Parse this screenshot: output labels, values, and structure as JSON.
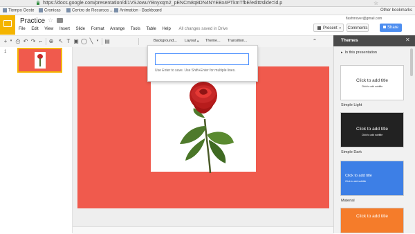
{
  "browser": {
    "url": "https://docs.google.com/presentation/d/1VSJowuYBnyxqm2_pENCm8q8DN4NYEBx4PTkmTfbE/edit#slide=id.p",
    "bookmarks": [
      "Tiempo Oeste",
      "Cronicas",
      "Centro de Recursos ...",
      "Animation - Backboard"
    ],
    "other_bookmarks": "Other bookmarks"
  },
  "app": {
    "title": "Practice",
    "user_email": "flashmover@gmail.com",
    "menu": [
      "File",
      "Edit",
      "View",
      "Insert",
      "Slide",
      "Format",
      "Arrange",
      "Tools",
      "Table",
      "Help"
    ],
    "save_status": "All changes saved in Drive",
    "present_label": "Present",
    "comments_label": "Comments",
    "share_label": "Share"
  },
  "toolbar": {
    "background_label": "Background...",
    "layout_label": "Layout",
    "theme_label": "Theme...",
    "transition_label": "Transition..."
  },
  "filmstrip": {
    "slide_number": "1"
  },
  "dialog": {
    "input_value": "",
    "hint": "Use Enter to save. Use Shift+Enter for multiple lines."
  },
  "themes": {
    "title": "Themes",
    "section": "In this presentation",
    "items": [
      {
        "name": "",
        "title": "Click to add title",
        "subtitle": "Click to add subtitle",
        "bg": "#ffffff",
        "fg": "#333333"
      },
      {
        "name": "Simple Light",
        "title": "Click to add title",
        "subtitle": "Click to add subtitle",
        "bg": "#222222",
        "fg": "#ffffff"
      },
      {
        "name": "Simple Dark",
        "title": "Click to add title",
        "subtitle": "Click to add subtitle",
        "bg": "#3d7fe6",
        "fg": "#ffffff"
      },
      {
        "name": "Material",
        "title": "Click to add title",
        "subtitle": "",
        "bg": "#f57c2a",
        "fg": "#ffffff"
      }
    ]
  },
  "colors": {
    "slide_background": "#f05a4d",
    "accent": "#f4b400",
    "share": "#4d8ef0"
  },
  "icons": [
    "lock-icon",
    "star-icon",
    "folder-icon",
    "slides-logo-icon",
    "present-icon",
    "close-icon",
    "rose-image"
  ]
}
